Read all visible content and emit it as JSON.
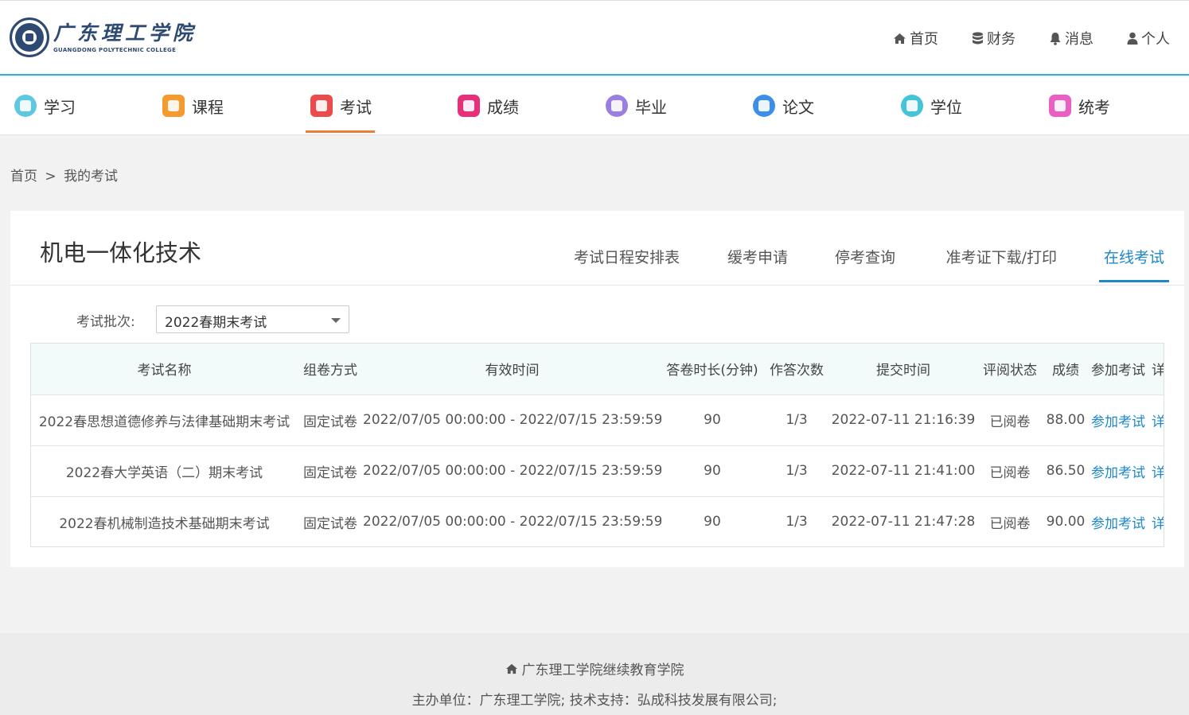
{
  "logo": {
    "cn": "广东理工学院",
    "en": "GUANGDONG POLYTECHNIC COLLEGE"
  },
  "top_nav": [
    {
      "label": "首页",
      "icon": "home-icon"
    },
    {
      "label": "财务",
      "icon": "database-icon"
    },
    {
      "label": "消息",
      "icon": "bell-icon"
    },
    {
      "label": "个人",
      "icon": "user-icon"
    }
  ],
  "modules": [
    {
      "label": "学习",
      "icon": "study-icon",
      "color": "#5cc9e0"
    },
    {
      "label": "课程",
      "icon": "course-icon",
      "color": "#f59a2f"
    },
    {
      "label": "考试",
      "icon": "exam-icon",
      "color": "#ec4b4b",
      "active": true
    },
    {
      "label": "成绩",
      "icon": "score-icon",
      "color": "#e8307a"
    },
    {
      "label": "毕业",
      "icon": "graduation-icon",
      "color": "#9b7fe0"
    },
    {
      "label": "论文",
      "icon": "thesis-icon",
      "color": "#3d8ee8"
    },
    {
      "label": "学位",
      "icon": "degree-icon",
      "color": "#45c3d8"
    },
    {
      "label": "统考",
      "icon": "unified-exam-icon",
      "color": "#ea5fc4"
    }
  ],
  "breadcrumb": {
    "home": "首页",
    "separator": ">",
    "current": "我的考试"
  },
  "course_title": "机电一体化技术",
  "tabs": [
    {
      "label": "考试日程安排表"
    },
    {
      "label": "缓考申请"
    },
    {
      "label": "停考查询"
    },
    {
      "label": "准考证下载/打印"
    },
    {
      "label": "在线考试",
      "active": true
    }
  ],
  "filter": {
    "label": "考试批次:",
    "selected": "2022春期末考试"
  },
  "table": {
    "headers": [
      "考试名称",
      "组卷方式",
      "有效时间",
      "答卷时长(分钟)",
      "作答次数",
      "提交时间",
      "评阅状态",
      "成绩",
      "参加考试",
      "详"
    ],
    "rows": [
      {
        "name": "2022春思想道德修养与法律基础期末考试",
        "mode": "固定试卷",
        "period": "2022/07/05 00:00:00 - 2022/07/15 23:59:59",
        "duration": "90",
        "attempts": "1/3",
        "submitted": "2022-07-11 21:16:39",
        "status": "已阅卷",
        "score": "88.00",
        "action": "参加考试",
        "detail": "详"
      },
      {
        "name": "2022春大学英语（二）期末考试",
        "mode": "固定试卷",
        "period": "2022/07/05 00:00:00 - 2022/07/15 23:59:59",
        "duration": "90",
        "attempts": "1/3",
        "submitted": "2022-07-11 21:41:00",
        "status": "已阅卷",
        "score": "86.50",
        "action": "参加考试",
        "detail": "详"
      },
      {
        "name": "2022春机械制造技术基础期末考试",
        "mode": "固定试卷",
        "period": "2022/07/05 00:00:00 - 2022/07/15 23:59:59",
        "duration": "90",
        "attempts": "1/3",
        "submitted": "2022-07-11 21:47:28",
        "status": "已阅卷",
        "score": "90.00",
        "action": "参加考试",
        "detail": "详"
      }
    ]
  },
  "footer": {
    "school": "广东理工学院继续教育学院",
    "credits": "主办单位：广东理工学院;   技术支持：弘成科技发展有限公司;"
  },
  "colors": {
    "header_border": "#39a9d6",
    "active_module_underline": "#e97f3b",
    "active_tab": "#1e88c7",
    "link": "#1e88c7",
    "table_header_bg": "#f3fafa"
  }
}
